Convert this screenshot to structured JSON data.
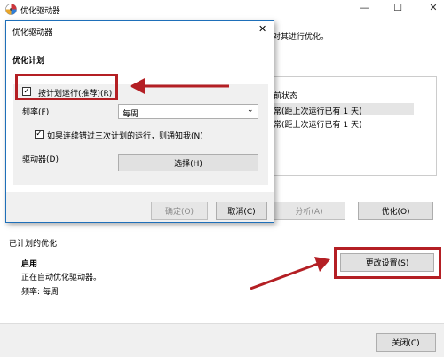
{
  "main_window": {
    "title": "优化驱动器",
    "intro_tail": "对其进行优化。",
    "table": {
      "status_header": "前状态",
      "rows": [
        "常(距上次运行已有 1 天)",
        "常(距上次运行已有 1 天)"
      ]
    },
    "analyze_label": "分析(A)",
    "optimize_label": "优化(O)",
    "scheduled_heading": "已计划的优化",
    "on_label": "启用",
    "auto_text": "正在自动优化驱动器。",
    "frequency_text": "频率: 每周",
    "change_settings_label": "更改设置(S)",
    "close_label": "关闭(C)"
  },
  "dialog": {
    "title": "优化驱动器",
    "section_title": "优化计划",
    "run_on_schedule_label": "按计划运行(推荐)(R)",
    "run_on_schedule_checked": true,
    "frequency_label": "频率(F)",
    "frequency_value": "每周",
    "notify_label": "如果连续错过三次计划的运行，则通知我(N)",
    "notify_checked": true,
    "drives_label": "驱动器(D)",
    "choose_label": "选择(H)",
    "ok_label": "确定(O)",
    "cancel_label": "取消(C)"
  },
  "colors": {
    "highlight_red": "#b41f24",
    "dialog_border": "#1e6fb9",
    "selected_row": "#e5e5e5"
  },
  "icons": [
    "defrag-app-icon",
    "minimize-icon",
    "maximize-icon",
    "close-icon",
    "check-icon",
    "chevron-down-icon",
    "arrow-icon"
  ]
}
